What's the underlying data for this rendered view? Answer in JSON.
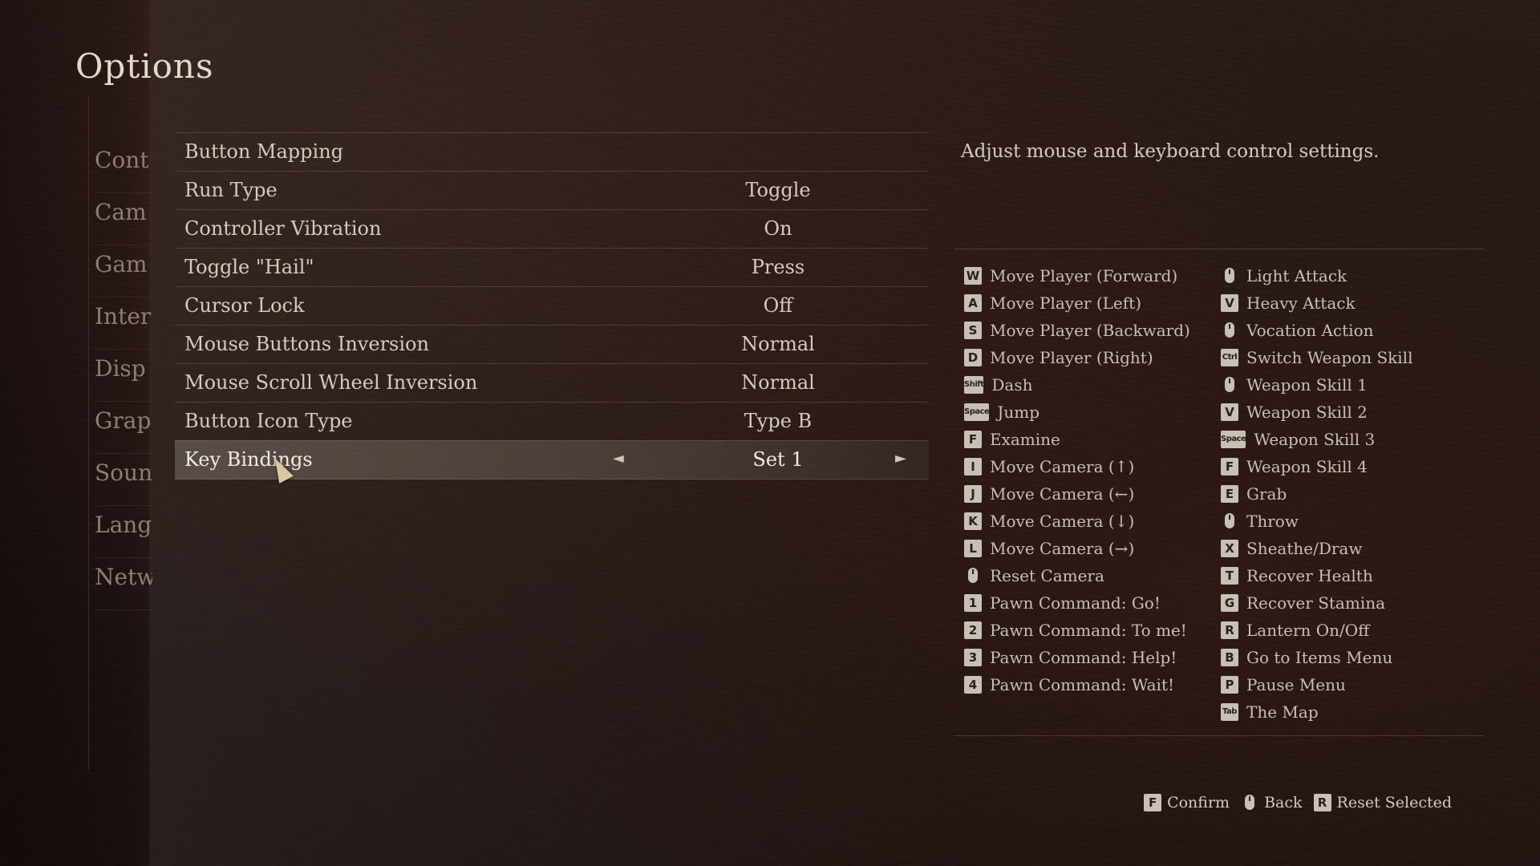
{
  "page": {
    "title": "Options"
  },
  "side_menu": [
    "Cont",
    "Cam",
    "Gam",
    "Inter",
    "Disp",
    "Grap",
    "Soun",
    "Lang",
    "Netw"
  ],
  "settings": [
    {
      "label": "Button Mapping",
      "value": ""
    },
    {
      "label": "Run Type",
      "value": "Toggle"
    },
    {
      "label": "Controller Vibration",
      "value": "On"
    },
    {
      "label": "Toggle \"Hail\"",
      "value": "Press"
    },
    {
      "label": "Cursor Lock",
      "value": "Off"
    },
    {
      "label": "Mouse Buttons Inversion",
      "value": "Normal"
    },
    {
      "label": "Mouse Scroll Wheel Inversion",
      "value": "Normal"
    },
    {
      "label": "Button Icon Type",
      "value": "Type B"
    },
    {
      "label": "Key Bindings",
      "value": "Set 1",
      "selected": true
    }
  ],
  "description": "Adjust mouse and keyboard control settings.",
  "bindings_left": [
    {
      "key": "W",
      "action": "Move Player (Forward)"
    },
    {
      "key": "A",
      "action": "Move Player (Left)"
    },
    {
      "key": "S",
      "action": "Move Player (Backward)"
    },
    {
      "key": "D",
      "action": "Move Player (Right)"
    },
    {
      "key": "Shift",
      "action": "Dash"
    },
    {
      "key": "Space",
      "action": "Jump"
    },
    {
      "key": "F",
      "action": "Examine"
    },
    {
      "key": "I",
      "action": "Move Camera (↑)"
    },
    {
      "key": "J",
      "action": "Move Camera (←)"
    },
    {
      "key": "K",
      "action": "Move Camera (↓)"
    },
    {
      "key": "L",
      "action": "Move Camera (→)"
    },
    {
      "key": "mouse-middle",
      "action": "Reset Camera"
    },
    {
      "key": "1",
      "action": "Pawn Command: Go!"
    },
    {
      "key": "2",
      "action": "Pawn Command: To me!"
    },
    {
      "key": "3",
      "action": "Pawn Command: Help!"
    },
    {
      "key": "4",
      "action": "Pawn Command: Wait!"
    }
  ],
  "bindings_right": [
    {
      "key": "mouse-left",
      "action": "Light Attack"
    },
    {
      "key": "V",
      "action": "Heavy Attack"
    },
    {
      "key": "mouse-right",
      "action": "Vocation Action"
    },
    {
      "key": "Ctrl",
      "action": "Switch Weapon Skill"
    },
    {
      "key": "mouse-left",
      "action": "Weapon Skill 1"
    },
    {
      "key": "V",
      "action": "Weapon Skill 2"
    },
    {
      "key": "Space",
      "action": "Weapon Skill 3"
    },
    {
      "key": "F",
      "action": "Weapon Skill 4"
    },
    {
      "key": "E",
      "action": "Grab"
    },
    {
      "key": "mouse-right",
      "action": "Throw"
    },
    {
      "key": "X",
      "action": "Sheathe/Draw"
    },
    {
      "key": "T",
      "action": "Recover Health"
    },
    {
      "key": "G",
      "action": "Recover Stamina"
    },
    {
      "key": "R",
      "action": "Lantern On/Off"
    },
    {
      "key": "B",
      "action": "Go to Items Menu"
    },
    {
      "key": "P",
      "action": "Pause Menu"
    },
    {
      "key": "Tab",
      "action": "The Map"
    }
  ],
  "footer": [
    {
      "key": "F",
      "label": "Confirm"
    },
    {
      "key": "mouse-right",
      "label": "Back"
    },
    {
      "key": "R",
      "label": "Reset Selected"
    }
  ]
}
